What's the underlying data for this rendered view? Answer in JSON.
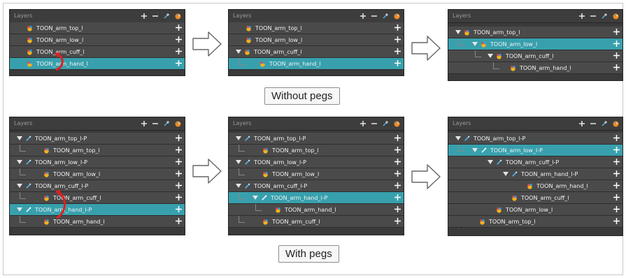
{
  "panel_title": "Layers",
  "captions": {
    "without": "Without pegs",
    "with": "With pegs"
  },
  "colors": {
    "panel_bg": "#3a3a3a",
    "row_bg": "#4a4a4a",
    "selected_row": "#38a0ad",
    "red_arrow": "#e02020"
  },
  "icons": {
    "drawing": "toon-color-icon",
    "peg": "peg-icon",
    "add": "plus-icon",
    "delete": "minus-icon",
    "add_peg": "add-peg-icon",
    "color": "palette-icon"
  },
  "panels": [
    {
      "rows": [
        {
          "label": "TOON_arm_top_l"
        },
        {
          "label": "TOON_arm_low_l"
        },
        {
          "label": "TOON_arm_cuff_l"
        },
        {
          "label": "TOON_arm_hand_l"
        }
      ]
    },
    {
      "rows": [
        {
          "label": "TOON_arm_top_l"
        },
        {
          "label": "TOON_arm_low_l"
        },
        {
          "label": "TOON_arm_cuff_l"
        },
        {
          "label": "TOON_arm_hand_l"
        }
      ]
    },
    {
      "rows": [
        {
          "label": "TOON_arm_top_l"
        },
        {
          "label": "TOON_arm_low_l"
        },
        {
          "label": "TOON_arm_cuff_l"
        },
        {
          "label": "TOON_arm_hand_l"
        }
      ]
    },
    {
      "rows": [
        {
          "label": "TOON_arm_top_l-P"
        },
        {
          "label": "TOON_arm_top_l"
        },
        {
          "label": "TOON_arm_low_l-P"
        },
        {
          "label": "TOON_arm_low_l"
        },
        {
          "label": "TOON_arm_cuff_l-P"
        },
        {
          "label": "TOON_arm_cuff_l"
        },
        {
          "label": "TOON_arm_hand_l-P"
        },
        {
          "label": "TOON_arm_hand_l"
        }
      ]
    },
    {
      "rows": [
        {
          "label": "TOON_arm_top_l-P"
        },
        {
          "label": "TOON_arm_top_l"
        },
        {
          "label": "TOON_arm_low_l-P"
        },
        {
          "label": "TOON_arm_low_l"
        },
        {
          "label": "TOON_arm_cuff_l-P"
        },
        {
          "label": "TOON_arm_hand_l-P"
        },
        {
          "label": "TOON_arm_hand_l"
        },
        {
          "label": "TOON_arm_cuff_l"
        }
      ]
    },
    {
      "rows": [
        {
          "label": "TOON_arm_top_l-P"
        },
        {
          "label": "TOON_arm_low_l-P"
        },
        {
          "label": "TOON_arm_cuff_l-P"
        },
        {
          "label": "TOON_arm_hand_l-P"
        },
        {
          "label": "TOON_arm_hand_l"
        },
        {
          "label": "TOON_arm_cuff_l"
        },
        {
          "label": "TOON_arm_low_l"
        },
        {
          "label": "TOON_arm_top_l"
        }
      ]
    }
  ]
}
